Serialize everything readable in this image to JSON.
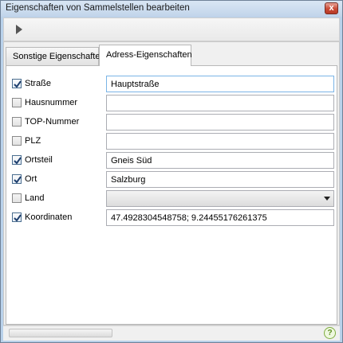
{
  "window": {
    "title": "Eigenschaften von Sammelstellen bearbeiten",
    "close_glyph": "x"
  },
  "toolbar": {
    "run_icon": "play-icon"
  },
  "tabs": [
    {
      "label": "Sonstige Eigenschaften",
      "active": false
    },
    {
      "label": "Adress-Eigenschaften",
      "active": true
    }
  ],
  "form": {
    "rows": [
      {
        "label": "Straße",
        "checked": true,
        "type": "text",
        "value": "Hauptstraße"
      },
      {
        "label": "Hausnummer",
        "checked": false,
        "type": "text",
        "value": ""
      },
      {
        "label": "TOP-Nummer",
        "checked": false,
        "type": "text",
        "value": ""
      },
      {
        "label": "PLZ",
        "checked": false,
        "type": "text",
        "value": ""
      },
      {
        "label": "Ortsteil",
        "checked": true,
        "type": "text",
        "value": "Gneis Süd"
      },
      {
        "label": "Ort",
        "checked": true,
        "type": "text",
        "value": "Salzburg"
      },
      {
        "label": "Land",
        "checked": false,
        "type": "select",
        "value": ""
      },
      {
        "label": "Koordinaten",
        "checked": true,
        "type": "text",
        "value": "47.4928304548758; 9.24455176261375"
      }
    ]
  },
  "status": {
    "progress": 0,
    "help_glyph": "?"
  },
  "colors": {
    "window_frame": "#b9d1ea",
    "checkbox_check": "#1f3f6e",
    "help_green": "#5d8f22"
  }
}
